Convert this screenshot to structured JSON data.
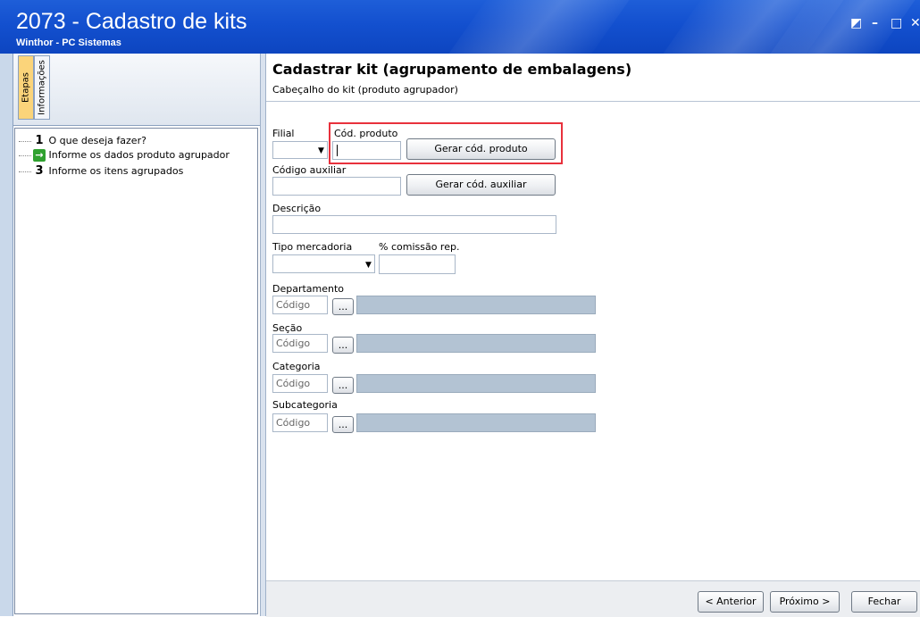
{
  "window": {
    "title": "2073 - Cadastro de kits",
    "subtitle": "Winthor - PC Sistemas",
    "controls": [
      "restore-icon",
      "minimize-icon",
      "maximize-icon",
      "close-icon"
    ],
    "restore_glyph": "◩",
    "minimize_glyph": "–",
    "maximize_glyph": "□",
    "close_glyph": "✕"
  },
  "sidebar": {
    "tabs": [
      {
        "label": "Etapas",
        "active": true
      },
      {
        "label": "Informações",
        "active": false
      }
    ],
    "steps": [
      {
        "marker": "1",
        "label": "O que deseja fazer?",
        "current": false
      },
      {
        "marker": "→",
        "label": "Informe os dados produto agrupador",
        "current": true
      },
      {
        "marker": "3",
        "label": "Informe os itens agrupados",
        "current": false
      }
    ]
  },
  "main": {
    "title": "Cadastrar kit (agrupamento de embalagens)",
    "subtitle": "Cabeçalho do kit (produto agrupador)",
    "filial_label": "Filial",
    "cod_produto_label": "Cód. produto",
    "gerar_cod_produto": "Gerar cód. produto",
    "codigo_auxiliar_label": "Código auxiliar",
    "gerar_cod_auxiliar": "Gerar cód. auxiliar",
    "descricao_label": "Descrição",
    "tipo_mercadoria_label": "Tipo mercadoria",
    "comissao_label": "% comissão rep.",
    "combo_arrow": "▼",
    "lookups": [
      {
        "label": "Departamento",
        "placeholder": "Código",
        "button": "..."
      },
      {
        "label": "Seção",
        "placeholder": "Código",
        "button": "..."
      },
      {
        "label": "Categoria",
        "placeholder": "Código",
        "button": "..."
      },
      {
        "label": "Subcategoria",
        "placeholder": "Código",
        "button": "..."
      }
    ]
  },
  "footer": {
    "anterior": "< Anterior",
    "proximo": "Próximo >",
    "fechar": "Fechar"
  },
  "colors": {
    "titlebar": "#1350cf",
    "highlight": "#e8313c",
    "readonly": "#b3c3d3",
    "active_tab": "#fbd47a"
  }
}
